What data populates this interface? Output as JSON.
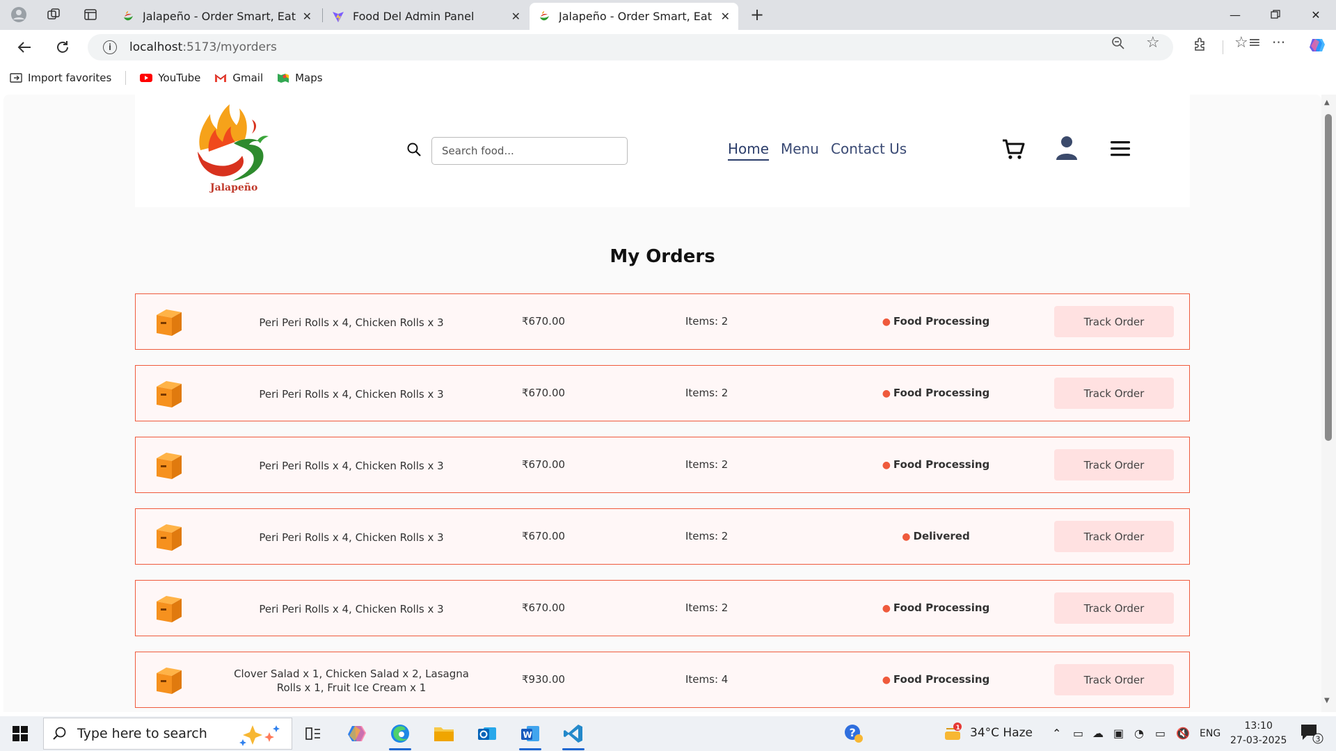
{
  "browser": {
    "tabs": [
      {
        "title": "Jalapeño - Order Smart, Eat Healt",
        "active": false
      },
      {
        "title": "Food Del Admin Panel",
        "active": false
      },
      {
        "title": "Jalapeño - Order Smart, Eat Healt",
        "active": true
      }
    ],
    "url_host": "localhost",
    "url_path": ":5173/myorders",
    "bookmarks": [
      "Import favorites",
      "YouTube",
      "Gmail",
      "Maps"
    ]
  },
  "site": {
    "logo_text": "Jalapeño",
    "search_placeholder": "Search food...",
    "nav": [
      "Home",
      "Menu",
      "Contact Us"
    ]
  },
  "page": {
    "title": "My Orders",
    "track_label": "Track Order",
    "orders": [
      {
        "items": "Peri Peri Rolls x 4, Chicken Rolls x 3",
        "amount": "₹670.00",
        "count": "Items: 2",
        "status": "Food Processing"
      },
      {
        "items": "Peri Peri Rolls x 4, Chicken Rolls x 3",
        "amount": "₹670.00",
        "count": "Items: 2",
        "status": "Food Processing"
      },
      {
        "items": "Peri Peri Rolls x 4, Chicken Rolls x 3",
        "amount": "₹670.00",
        "count": "Items: 2",
        "status": "Food Processing"
      },
      {
        "items": "Peri Peri Rolls x 4, Chicken Rolls x 3",
        "amount": "₹670.00",
        "count": "Items: 2",
        "status": "Delivered"
      },
      {
        "items": "Peri Peri Rolls x 4, Chicken Rolls x 3",
        "amount": "₹670.00",
        "count": "Items: 2",
        "status": "Food Processing"
      },
      {
        "items": "Clover Salad x 1, Chicken Salad x 2, Lasagna Rolls x 1, Fruit Ice Cream x 1",
        "amount": "₹930.00",
        "count": "Items: 4",
        "status": "Food Processing"
      }
    ]
  },
  "taskbar": {
    "search_placeholder": "Type here to search",
    "weather": "34°C  Haze",
    "lang": "ENG",
    "time": "13:10",
    "date": "27-03-2025",
    "notif_count": "3",
    "weather_badge": "1"
  },
  "colors": {
    "accent": "#ef5a3c",
    "track_button_bg": "#ffe1e1",
    "nav_text": "#3a4a74"
  }
}
